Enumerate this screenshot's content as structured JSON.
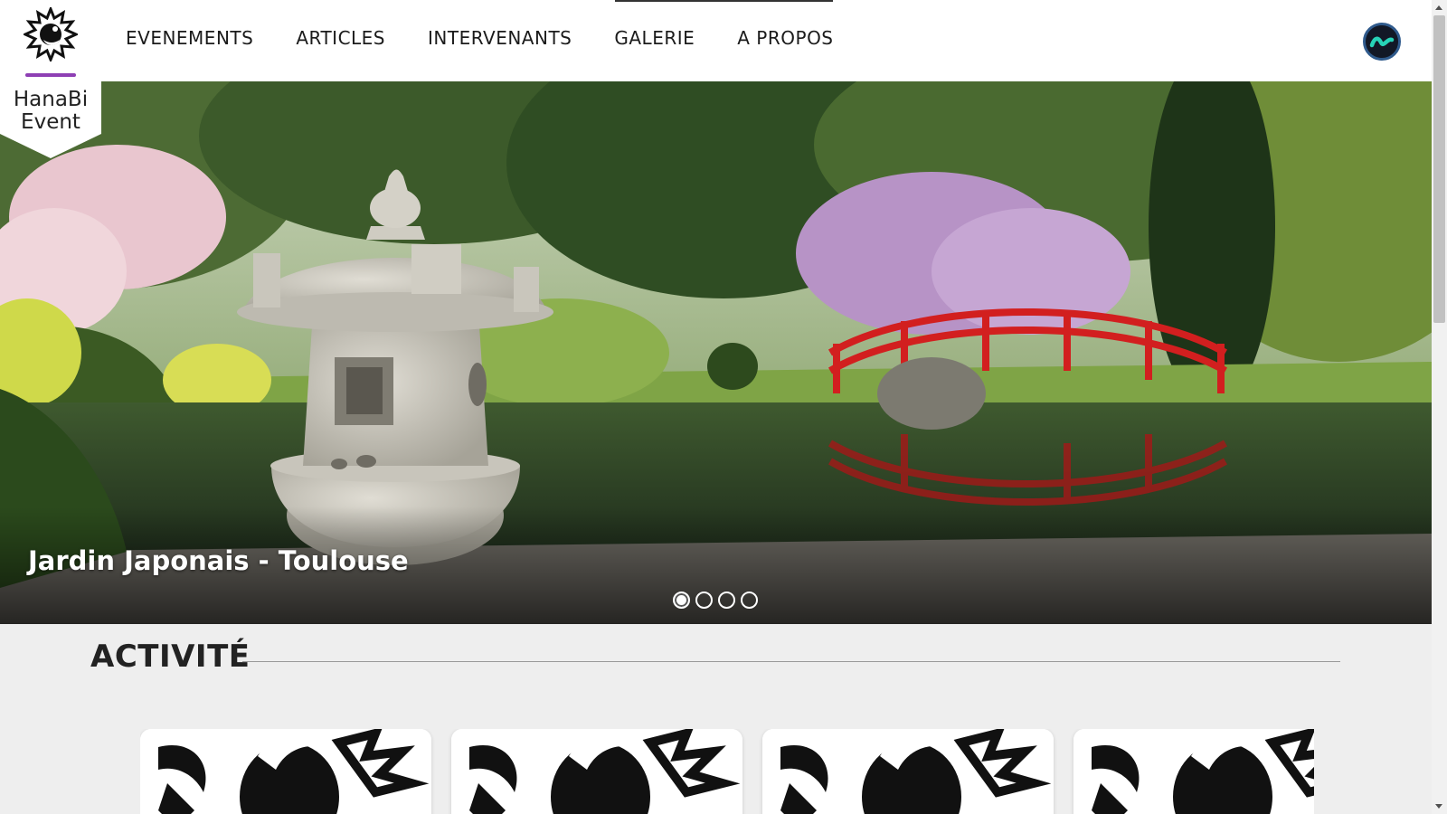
{
  "header": {
    "brand_line1": "HanaBi",
    "brand_line2": "Event",
    "nav": [
      {
        "label": "EVENEMENTS"
      },
      {
        "label": "ARTICLES"
      },
      {
        "label": "INTERVENANTS"
      },
      {
        "label": "GALERIE"
      },
      {
        "label": "A PROPOS"
      }
    ],
    "accent_color": "#8e3fb4"
  },
  "hero": {
    "caption": "Jardin Japonais - Toulouse",
    "slide_count": 4,
    "active_slide": 1
  },
  "section": {
    "title": "ACTIVITÉ"
  },
  "icons": {
    "logo": "phoenix-flower-logo-icon",
    "account": "account-avatar-icon"
  }
}
